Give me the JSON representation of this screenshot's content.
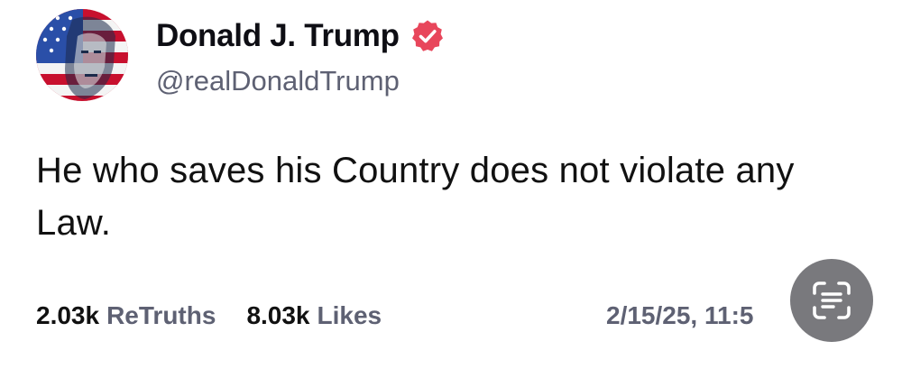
{
  "author": {
    "display_name": "Donald J. Trump",
    "handle": "@realDonaldTrump",
    "avatar_icon": "flag-portrait-avatar",
    "verified_icon": "verified-badge-icon",
    "verified_color": "#e8465b"
  },
  "post": {
    "text": "He who saves his Country does not violate any Law."
  },
  "stats": {
    "retruths_value": "2.03k",
    "retruths_label": "ReTruths",
    "likes_value": "8.03k",
    "likes_label": "Likes"
  },
  "timestamp": "2/15/25, 11:5",
  "overlay": {
    "scan_icon": "live-text-scan-icon"
  }
}
